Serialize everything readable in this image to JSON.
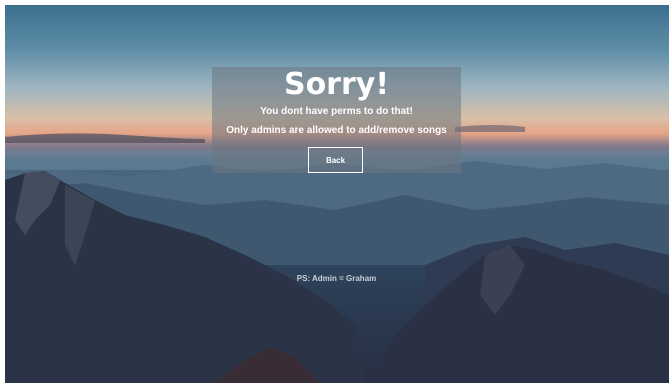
{
  "error": {
    "title": "Sorry!",
    "message_line1": "You dont have perms to do that!",
    "message_line2": "Only admins are allowed to add/remove songs",
    "back_button_label": "Back"
  },
  "footer": {
    "ps_text": "PS: Admin = Graham"
  }
}
